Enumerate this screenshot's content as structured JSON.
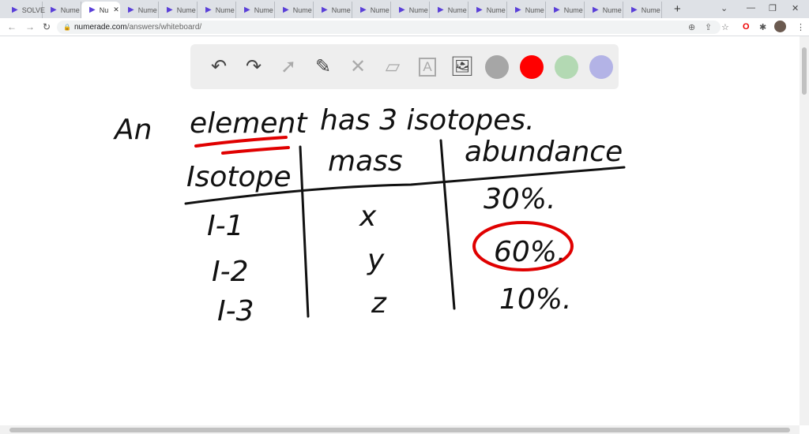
{
  "browser": {
    "tabs": [
      {
        "label": "SOLVE",
        "active": false
      },
      {
        "label": "Nume",
        "active": false
      },
      {
        "label": "Nu",
        "active": true
      },
      {
        "label": "Nume",
        "active": false
      },
      {
        "label": "Nume",
        "active": false
      },
      {
        "label": "Nume",
        "active": false
      },
      {
        "label": "Nume",
        "active": false
      },
      {
        "label": "Nume",
        "active": false
      },
      {
        "label": "Nume",
        "active": false
      },
      {
        "label": "Nume",
        "active": false
      },
      {
        "label": "Nume",
        "active": false
      },
      {
        "label": "Nume",
        "active": false
      },
      {
        "label": "Nume",
        "active": false
      },
      {
        "label": "Nume",
        "active": false
      },
      {
        "label": "Nume",
        "active": false
      },
      {
        "label": "Nume",
        "active": false
      },
      {
        "label": "Nume",
        "active": false
      }
    ],
    "url_host": "numerade.com",
    "url_path": "/answers/whiteboard/"
  },
  "toolbar": {
    "tools": [
      "undo-icon",
      "redo-icon",
      "pointer-icon",
      "pen-icon",
      "tools-icon",
      "eraser-icon",
      "text-icon",
      "image-icon"
    ],
    "colors": [
      "#a6a6a6",
      "#ff0000",
      "#b3d9b3",
      "#b3b3e6"
    ]
  },
  "whiteboard": {
    "heading_pre": "An",
    "heading_word": "element",
    "heading_post": "has 3 isotopes.",
    "headers": [
      "Isotope",
      "mass",
      "abundance"
    ],
    "rows": [
      {
        "isotope": "I-1",
        "mass": "x",
        "abundance": "30%."
      },
      {
        "isotope": "I-2",
        "mass": "y",
        "abundance": "60%."
      },
      {
        "isotope": "I-3",
        "mass": "z",
        "abundance": "10%."
      }
    ],
    "ink_color": "#111111",
    "highlight_color": "#e00000"
  }
}
